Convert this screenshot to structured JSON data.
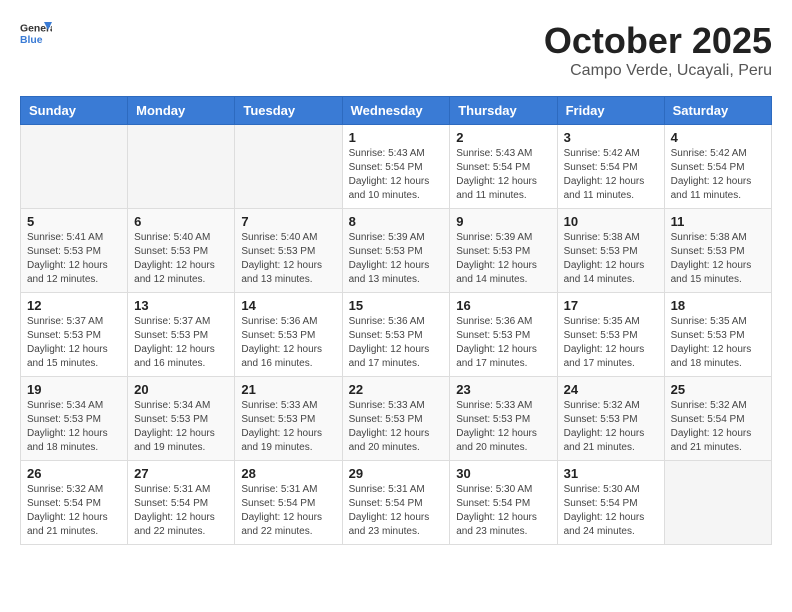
{
  "header": {
    "logo_line1": "General",
    "logo_line2": "Blue",
    "month_title": "October 2025",
    "location": "Campo Verde, Ucayali, Peru"
  },
  "weekdays": [
    "Sunday",
    "Monday",
    "Tuesday",
    "Wednesday",
    "Thursday",
    "Friday",
    "Saturday"
  ],
  "weeks": [
    [
      {
        "day": "",
        "info": ""
      },
      {
        "day": "",
        "info": ""
      },
      {
        "day": "",
        "info": ""
      },
      {
        "day": "1",
        "info": "Sunrise: 5:43 AM\nSunset: 5:54 PM\nDaylight: 12 hours\nand 10 minutes."
      },
      {
        "day": "2",
        "info": "Sunrise: 5:43 AM\nSunset: 5:54 PM\nDaylight: 12 hours\nand 11 minutes."
      },
      {
        "day": "3",
        "info": "Sunrise: 5:42 AM\nSunset: 5:54 PM\nDaylight: 12 hours\nand 11 minutes."
      },
      {
        "day": "4",
        "info": "Sunrise: 5:42 AM\nSunset: 5:54 PM\nDaylight: 12 hours\nand 11 minutes."
      }
    ],
    [
      {
        "day": "5",
        "info": "Sunrise: 5:41 AM\nSunset: 5:53 PM\nDaylight: 12 hours\nand 12 minutes."
      },
      {
        "day": "6",
        "info": "Sunrise: 5:40 AM\nSunset: 5:53 PM\nDaylight: 12 hours\nand 12 minutes."
      },
      {
        "day": "7",
        "info": "Sunrise: 5:40 AM\nSunset: 5:53 PM\nDaylight: 12 hours\nand 13 minutes."
      },
      {
        "day": "8",
        "info": "Sunrise: 5:39 AM\nSunset: 5:53 PM\nDaylight: 12 hours\nand 13 minutes."
      },
      {
        "day": "9",
        "info": "Sunrise: 5:39 AM\nSunset: 5:53 PM\nDaylight: 12 hours\nand 14 minutes."
      },
      {
        "day": "10",
        "info": "Sunrise: 5:38 AM\nSunset: 5:53 PM\nDaylight: 12 hours\nand 14 minutes."
      },
      {
        "day": "11",
        "info": "Sunrise: 5:38 AM\nSunset: 5:53 PM\nDaylight: 12 hours\nand 15 minutes."
      }
    ],
    [
      {
        "day": "12",
        "info": "Sunrise: 5:37 AM\nSunset: 5:53 PM\nDaylight: 12 hours\nand 15 minutes."
      },
      {
        "day": "13",
        "info": "Sunrise: 5:37 AM\nSunset: 5:53 PM\nDaylight: 12 hours\nand 16 minutes."
      },
      {
        "day": "14",
        "info": "Sunrise: 5:36 AM\nSunset: 5:53 PM\nDaylight: 12 hours\nand 16 minutes."
      },
      {
        "day": "15",
        "info": "Sunrise: 5:36 AM\nSunset: 5:53 PM\nDaylight: 12 hours\nand 17 minutes."
      },
      {
        "day": "16",
        "info": "Sunrise: 5:36 AM\nSunset: 5:53 PM\nDaylight: 12 hours\nand 17 minutes."
      },
      {
        "day": "17",
        "info": "Sunrise: 5:35 AM\nSunset: 5:53 PM\nDaylight: 12 hours\nand 17 minutes."
      },
      {
        "day": "18",
        "info": "Sunrise: 5:35 AM\nSunset: 5:53 PM\nDaylight: 12 hours\nand 18 minutes."
      }
    ],
    [
      {
        "day": "19",
        "info": "Sunrise: 5:34 AM\nSunset: 5:53 PM\nDaylight: 12 hours\nand 18 minutes."
      },
      {
        "day": "20",
        "info": "Sunrise: 5:34 AM\nSunset: 5:53 PM\nDaylight: 12 hours\nand 19 minutes."
      },
      {
        "day": "21",
        "info": "Sunrise: 5:33 AM\nSunset: 5:53 PM\nDaylight: 12 hours\nand 19 minutes."
      },
      {
        "day": "22",
        "info": "Sunrise: 5:33 AM\nSunset: 5:53 PM\nDaylight: 12 hours\nand 20 minutes."
      },
      {
        "day": "23",
        "info": "Sunrise: 5:33 AM\nSunset: 5:53 PM\nDaylight: 12 hours\nand 20 minutes."
      },
      {
        "day": "24",
        "info": "Sunrise: 5:32 AM\nSunset: 5:53 PM\nDaylight: 12 hours\nand 21 minutes."
      },
      {
        "day": "25",
        "info": "Sunrise: 5:32 AM\nSunset: 5:54 PM\nDaylight: 12 hours\nand 21 minutes."
      }
    ],
    [
      {
        "day": "26",
        "info": "Sunrise: 5:32 AM\nSunset: 5:54 PM\nDaylight: 12 hours\nand 21 minutes."
      },
      {
        "day": "27",
        "info": "Sunrise: 5:31 AM\nSunset: 5:54 PM\nDaylight: 12 hours\nand 22 minutes."
      },
      {
        "day": "28",
        "info": "Sunrise: 5:31 AM\nSunset: 5:54 PM\nDaylight: 12 hours\nand 22 minutes."
      },
      {
        "day": "29",
        "info": "Sunrise: 5:31 AM\nSunset: 5:54 PM\nDaylight: 12 hours\nand 23 minutes."
      },
      {
        "day": "30",
        "info": "Sunrise: 5:30 AM\nSunset: 5:54 PM\nDaylight: 12 hours\nand 23 minutes."
      },
      {
        "day": "31",
        "info": "Sunrise: 5:30 AM\nSunset: 5:54 PM\nDaylight: 12 hours\nand 24 minutes."
      },
      {
        "day": "",
        "info": ""
      }
    ]
  ]
}
